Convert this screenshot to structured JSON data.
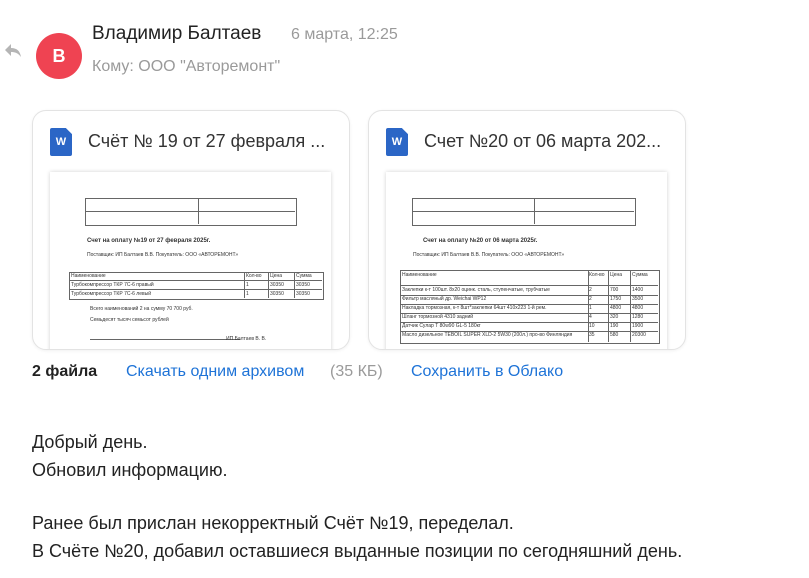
{
  "sender": {
    "name": "Владимир Балтаев",
    "initial": "В",
    "date": "6 марта, 12:25",
    "recipient": "Кому: ООО \"Авторемонт\"",
    "avatar_color": "#ef4352"
  },
  "attachments": [
    {
      "name": "Счёт № 19 от 27 февраля ...",
      "icon": "word-icon",
      "preview": {
        "title": "Счет на оплату №19 от 27 февраля 2025г.",
        "supplier": "Поставщик: ИП Балтаев В.В. Покупатель: ООО «АВТОРЕМОНТ»",
        "headers": [
          "Наименование",
          "Кол-во",
          "Цена",
          "Сумма"
        ],
        "rows": [
          [
            "Турбокомпрессор ТКР 7С-6 правый",
            "1",
            "30350",
            "30350"
          ],
          [
            "Турбокомпрессор ТКР 7С-6 левый",
            "1",
            "30350",
            "30350"
          ]
        ],
        "total_line": "Всего наименований 2 на сумму 70 700 руб.",
        "words_line": "Семьдесят тысяч семьсот рублей",
        "signature": "ИП Балтаев В. В."
      }
    },
    {
      "name": "Счет №20 от 06 марта 202...",
      "icon": "word-icon",
      "preview": {
        "title": "Счет на оплату №20 от 06 марта 2025г.",
        "supplier": "Поставщик: ИП Балтаев В.В. Покупатель: ООО «АВТОРЕМОНТ»",
        "headers": [
          "Наименование",
          "Кол-во",
          "Цена",
          "Сумма"
        ],
        "rows": [
          [
            "Заклепки к-т 100шт. 8х20 оцинк. сталь, ступенчатые, трубчатые",
            "2",
            "700",
            "1400"
          ],
          [
            "Фильтр масляный др. Weichai WP12",
            "2",
            "1750",
            "3500"
          ],
          [
            "Накладка тормозная, к-т 8шт*заклепки 64шт 410х223 1-й рем.",
            "1",
            "4800",
            "4800"
          ],
          [
            "Шланг тормозной 4310 задний",
            "4",
            "320",
            "1280"
          ],
          [
            "Датчик Сулар Т 80w90 GL-5 180кг",
            "10",
            "190",
            "1900"
          ],
          [
            "Масло дизельное TEBOIL SUPER XLD-2 5W30 (200л.) про-во Финляндия",
            "35",
            "580",
            "20300"
          ]
        ]
      }
    }
  ],
  "footer": {
    "files_count": "2 файла",
    "download_label": "Скачать одним архивом",
    "size": "(35 КБ)",
    "save_label": "Сохранить в Облако"
  },
  "message": {
    "lines": [
      "Добрый день.",
      "Обновил информацию.",
      "Ранее был прислан некорректный Счёт №19, переделал.",
      "В Счёте №20, добавил оставшиеся выданные позиции по сегодняшний день."
    ]
  }
}
